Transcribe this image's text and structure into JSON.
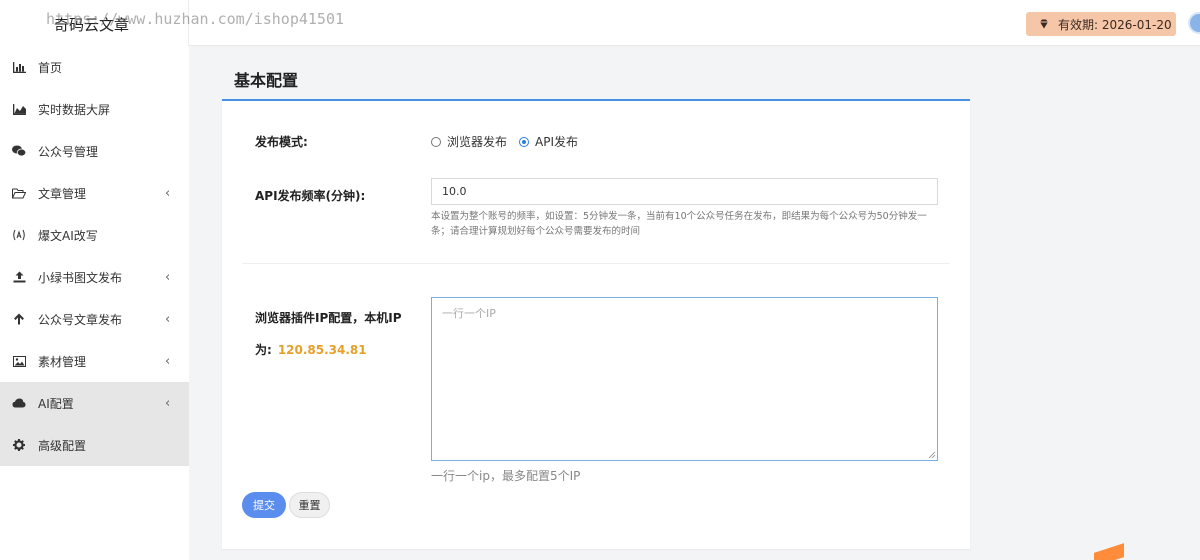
{
  "header": {
    "brand": "奇码云文章",
    "watermark": "https://www.huzhan.com/ishop41501",
    "expiry": "有效期: 2026-01-20"
  },
  "sidebar": {
    "items": [
      {
        "label": "首页",
        "icon": "bar-chart-icon"
      },
      {
        "label": "实时数据大屏",
        "icon": "area-chart-icon"
      },
      {
        "label": "公众号管理",
        "icon": "wechat-icon"
      },
      {
        "label": "文章管理",
        "icon": "folder-open-icon",
        "chevron": "‹"
      },
      {
        "label": "爆文AI改写",
        "icon": "ai-icon"
      },
      {
        "label": "小绿书图文发布",
        "icon": "upload-icon",
        "chevron": "‹"
      },
      {
        "label": "公众号文章发布",
        "icon": "arrow-up-icon",
        "chevron": "‹"
      },
      {
        "label": "素材管理",
        "icon": "image-icon",
        "chevron": "‹"
      },
      {
        "label": "AI配置",
        "icon": "cloud-icon",
        "chevron": "‹"
      },
      {
        "label": "高级配置",
        "icon": "gear-icon"
      }
    ]
  },
  "main": {
    "title": "基本配置",
    "publish_mode": {
      "label": "发布模式:",
      "options": [
        "浏览器发布",
        "API发布"
      ],
      "selected": "API发布"
    },
    "frequency": {
      "label": "API发布频率(分钟):",
      "value": "10.0",
      "hint": "本设置为整个账号的频率，如设置：5分钟发一条，当前有10个公众号任务在发布，即结果为每个公众号为50分钟发一条；请合理计算规划好每个公众号需要发布的时间"
    },
    "ip_config": {
      "label_line1": "浏览器插件IP配置，本机IP",
      "label_line2": "为:",
      "ip": "120.85.34.81",
      "placeholder": "一行一个IP",
      "hint": "一行一个ip，最多配置5个IP"
    },
    "buttons": {
      "submit": "提交",
      "reset": "重置"
    }
  },
  "colors": {
    "accent": "#4a90e2",
    "submit": "#5b8def",
    "ip": "#e6a02a",
    "expiry_bg": "#f6c6a8"
  }
}
